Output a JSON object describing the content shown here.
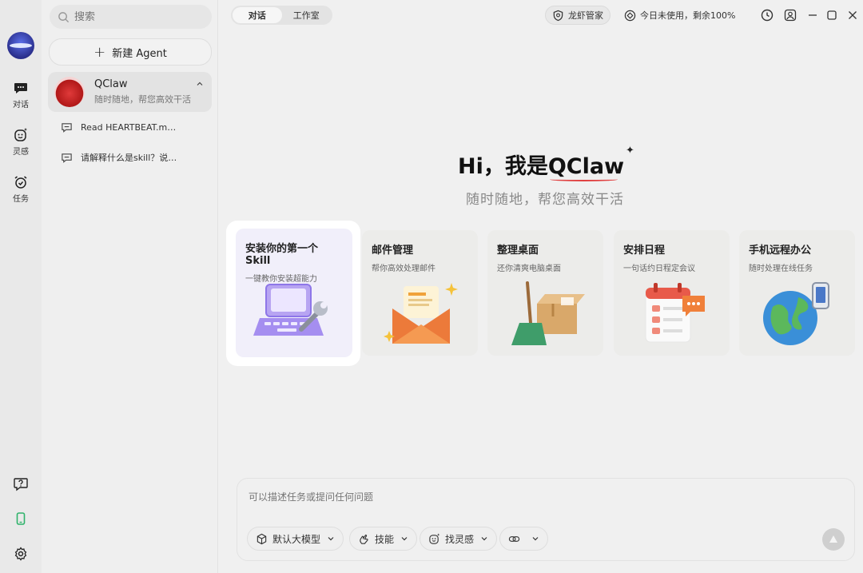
{
  "rail": {
    "items": [
      {
        "label": "对话",
        "icon": "chat-bubble-icon"
      },
      {
        "label": "灵感",
        "icon": "sparkle-face-icon"
      },
      {
        "label": "任务",
        "icon": "alarm-clock-icon"
      }
    ],
    "bottom_icons": [
      "help-icon",
      "phone-icon",
      "gear-icon"
    ]
  },
  "sidebar": {
    "search_placeholder": "搜索",
    "new_agent_label": "新建 Agent",
    "agent": {
      "name": "QClaw",
      "subtitle": "随时随地，帮您高效干活"
    },
    "conversations": [
      {
        "title": "Read HEARTBEAT.m…"
      },
      {
        "title": "请解释什么是skill？说…"
      }
    ]
  },
  "topbar": {
    "tabs": [
      {
        "label": "对话",
        "active": true
      },
      {
        "label": "工作室",
        "active": false
      }
    ],
    "manager_label": "龙虾管家",
    "usage_label": "今日未使用，剩余100%"
  },
  "hero": {
    "title_prefix": "Hi，我是",
    "title_brand": "QClaw",
    "subtitle": "随时随地，帮您高效干活"
  },
  "cards": [
    {
      "title": "安装你的第一个Skill",
      "desc": "一键教你安装超能力",
      "featured": true
    },
    {
      "title": "邮件管理",
      "desc": "帮你高效处理邮件"
    },
    {
      "title": "整理桌面",
      "desc": "还你清爽电脑桌面"
    },
    {
      "title": "安排日程",
      "desc": "一句话约日程定会议"
    },
    {
      "title": "手机远程办公",
      "desc": "随时处理在线任务"
    }
  ],
  "composer": {
    "placeholder": "可以描述任务或提问任何问题",
    "chips": [
      {
        "label": "默认大模型"
      },
      {
        "label": "技能"
      },
      {
        "label": "找灵感"
      },
      {
        "label": ""
      }
    ]
  },
  "colors": {
    "accent_red": "#e04040",
    "featured_bg": "#f1effa",
    "highlight": "#ffffff"
  }
}
